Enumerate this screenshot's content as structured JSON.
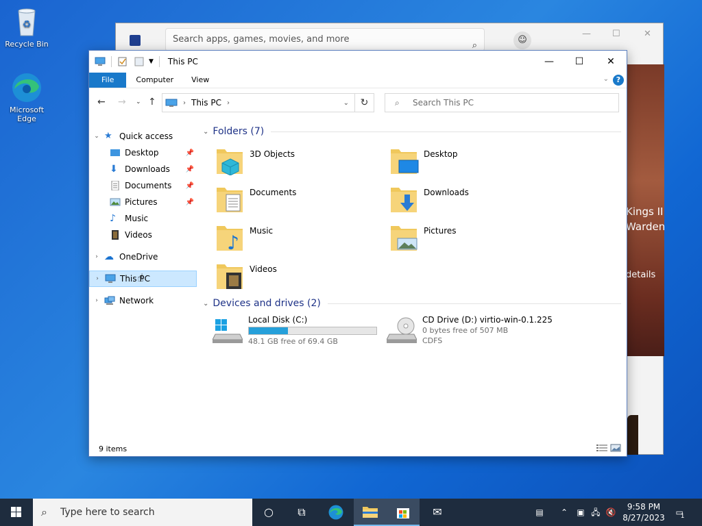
{
  "desktop": {
    "icons": [
      {
        "label": "Recycle Bin"
      },
      {
        "label": "Microsoft Edge"
      }
    ]
  },
  "store": {
    "search_placeholder": "Search apps, games, movies, and more",
    "hero_lines": [
      "Kings II",
      "Warden",
      "details"
    ]
  },
  "explorer": {
    "title": "This PC",
    "ribbon_tabs": [
      "File",
      "Computer",
      "View"
    ],
    "help": "?",
    "address": {
      "path": "This PC"
    },
    "search_placeholder": "Search This PC",
    "tree": {
      "quick_access": "Quick access",
      "quick_items": [
        {
          "label": "Desktop",
          "pinned": true
        },
        {
          "label": "Downloads",
          "pinned": true
        },
        {
          "label": "Documents",
          "pinned": true
        },
        {
          "label": "Pictures",
          "pinned": true
        },
        {
          "label": "Music",
          "pinned": false
        },
        {
          "label": "Videos",
          "pinned": false
        }
      ],
      "onedrive": "OneDrive",
      "this_pc": "This PC",
      "network": "Network"
    },
    "folders_header": "Folders (7)",
    "folders": [
      {
        "name": "3D Objects",
        "icon": "3d-objects-icon"
      },
      {
        "name": "Desktop",
        "icon": "desktop-folder-icon"
      },
      {
        "name": "Documents",
        "icon": "documents-folder-icon"
      },
      {
        "name": "Downloads",
        "icon": "downloads-folder-icon"
      },
      {
        "name": "Music",
        "icon": "music-folder-icon"
      },
      {
        "name": "Pictures",
        "icon": "pictures-folder-icon"
      },
      {
        "name": "Videos",
        "icon": "videos-folder-icon"
      }
    ],
    "drives_header": "Devices and drives (2)",
    "drives": [
      {
        "name": "Local Disk (C:)",
        "free_text": "48.1 GB free of 69.4 GB",
        "used_fraction": 0.307
      },
      {
        "name": "CD Drive (D:) virtio-win-0.1.225",
        "free_text": "0 bytes free of 507 MB",
        "fs": "CDFS"
      }
    ],
    "status": "9 items"
  },
  "taskbar": {
    "search_placeholder": "Type here to search",
    "time": "9:58 PM",
    "date": "8/27/2023",
    "notification_count": "1"
  }
}
